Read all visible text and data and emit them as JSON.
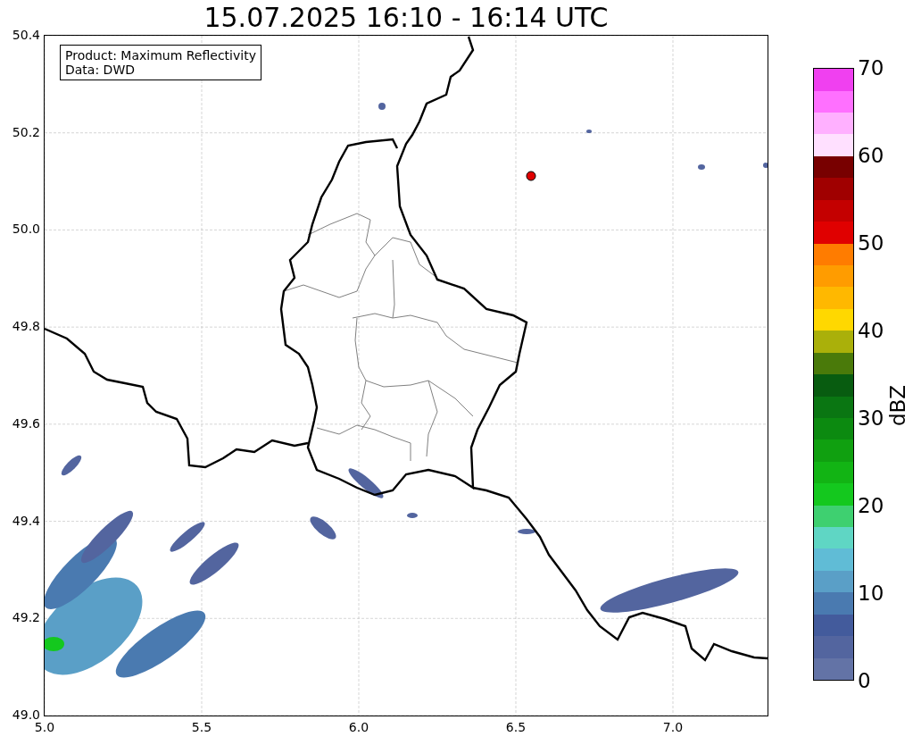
{
  "title": "15.07.2025 16:10 - 16:14 UTC",
  "info_box": [
    "Product: Maximum Reflectivity",
    "Data: DWD"
  ],
  "x_ticks": [
    "5.0",
    "5.5",
    "6.0",
    "6.5",
    "7.0"
  ],
  "y_ticks": [
    "50.4",
    "50.2",
    "50.0",
    "49.8",
    "49.6",
    "49.4",
    "49.2",
    "49.0"
  ],
  "colorbar": {
    "label": "dBZ",
    "ticks": [
      "70",
      "60",
      "50",
      "40",
      "30",
      "20",
      "10",
      "0"
    ],
    "bands": [
      {
        "color": "#6373a6"
      },
      {
        "color": "#53659f"
      },
      {
        "color": "#435b9c"
      },
      {
        "color": "#4a7ab0"
      },
      {
        "color": "#5a9fc7"
      },
      {
        "color": "#60bcd6"
      },
      {
        "color": "#5fd6c4"
      },
      {
        "color": "#3ed070"
      },
      {
        "color": "#14c81e"
      },
      {
        "color": "#12b414"
      },
      {
        "color": "#10a010"
      },
      {
        "color": "#0c8a10"
      },
      {
        "color": "#0a7612"
      },
      {
        "color": "#085c10"
      },
      {
        "color": "#4a7a0a"
      },
      {
        "color": "#aab00a"
      },
      {
        "color": "#ffd800"
      },
      {
        "color": "#ffb800"
      },
      {
        "color": "#ff9c00"
      },
      {
        "color": "#ff7c00"
      },
      {
        "color": "#e00000"
      },
      {
        "color": "#c40000"
      },
      {
        "color": "#a00000"
      },
      {
        "color": "#780000"
      },
      {
        "color": "#ffe0ff"
      },
      {
        "color": "#ffb0ff"
      },
      {
        "color": "#ff70ff"
      },
      {
        "color": "#f040f0"
      }
    ]
  }
}
